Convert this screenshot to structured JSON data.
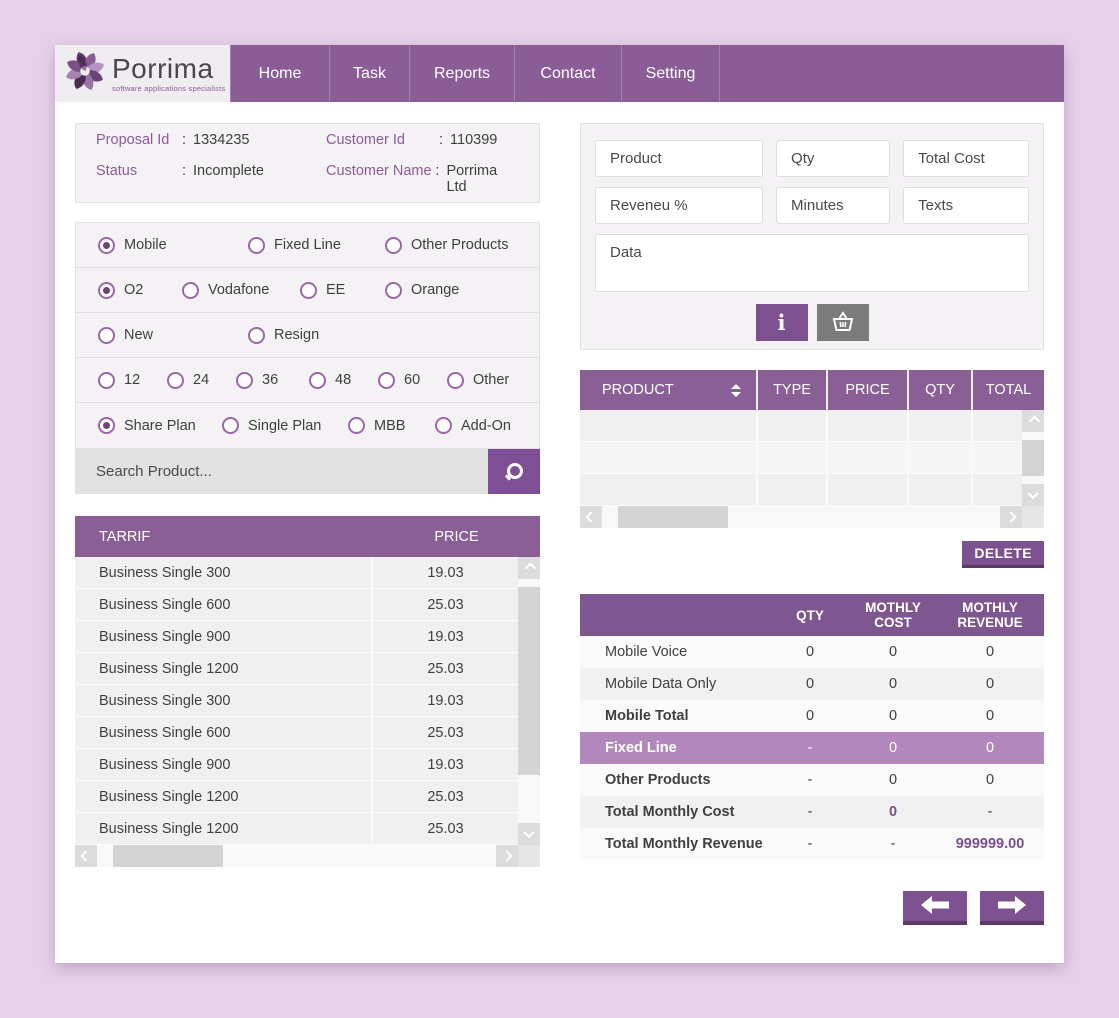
{
  "brand": {
    "name": "Porrima",
    "tagline": "software applications specialists"
  },
  "nav": {
    "items": [
      {
        "label": "Home"
      },
      {
        "label": "Task"
      },
      {
        "label": "Reports"
      },
      {
        "label": "Contact"
      },
      {
        "label": "Setting"
      }
    ]
  },
  "proposal_info": {
    "separator": ":",
    "proposal_id_label": "Proposal Id",
    "proposal_id": "1334235",
    "customer_id_label": "Customer Id",
    "customer_id": "110399",
    "status_label": "Status",
    "status": "Incomplete",
    "customer_name_label": "Customer Name",
    "customer_name": "Porrima Ltd"
  },
  "options": {
    "groups": [
      {
        "options": [
          {
            "label": "Mobile",
            "selected": true
          },
          {
            "label": "Fixed Line",
            "selected": false
          },
          {
            "label": "Other Products",
            "selected": false
          }
        ]
      },
      {
        "options": [
          {
            "label": "O2",
            "selected": true
          },
          {
            "label": "Vodafone",
            "selected": false
          },
          {
            "label": "EE",
            "selected": false
          },
          {
            "label": "Orange",
            "selected": false
          }
        ]
      },
      {
        "options": [
          {
            "label": "New",
            "selected": false
          },
          {
            "label": "Resign",
            "selected": false
          }
        ]
      },
      {
        "options": [
          {
            "label": "12",
            "selected": false
          },
          {
            "label": "24",
            "selected": false
          },
          {
            "label": "36",
            "selected": false
          },
          {
            "label": "48",
            "selected": false
          },
          {
            "label": "60",
            "selected": false
          },
          {
            "label": "Other",
            "selected": false
          }
        ]
      },
      {
        "options": [
          {
            "label": "Share Plan",
            "selected": true
          },
          {
            "label": "Single Plan",
            "selected": false
          },
          {
            "label": "MBB",
            "selected": false
          },
          {
            "label": "Add-On",
            "selected": false
          }
        ]
      }
    ]
  },
  "search": {
    "placeholder": "Search Product..."
  },
  "tariff_table": {
    "headers": {
      "tarrif": "TARRIF",
      "price": "PRICE"
    },
    "rows": [
      {
        "tarrif": "Business Single 300",
        "price": "19.03"
      },
      {
        "tarrif": "Business Single 600",
        "price": "25.03"
      },
      {
        "tarrif": "Business Single 900",
        "price": "19.03"
      },
      {
        "tarrif": "Business Single 1200",
        "price": "25.03"
      },
      {
        "tarrif": "Business Single 300",
        "price": "19.03"
      },
      {
        "tarrif": "Business Single 600",
        "price": "25.03"
      },
      {
        "tarrif": "Business Single 900",
        "price": "19.03"
      },
      {
        "tarrif": "Business Single 1200",
        "price": "25.03"
      },
      {
        "tarrif": "Business Single 1200",
        "price": "25.03"
      }
    ]
  },
  "product_form": {
    "product_placeholder": "Product",
    "qty_placeholder": "Qty",
    "total_cost_placeholder": "Total Cost",
    "revenue_placeholder": "Reveneu %",
    "minutes_placeholder": "Minutes",
    "texts_placeholder": "Texts",
    "data_placeholder": "Data"
  },
  "product_table": {
    "headers": {
      "product": "PRODUCT",
      "type": "TYPE",
      "price": "PRICE",
      "qty": "QTY",
      "total": "TOTAL"
    },
    "empty_row_count": 3
  },
  "actions": {
    "delete_label": "DELETE"
  },
  "summary_table": {
    "headers": {
      "label": "",
      "qty": "QTY",
      "cost": "MOTHLY COST",
      "revenue": "MOTHLY REVENUE"
    },
    "rows": [
      {
        "label": "Mobile Voice",
        "qty": "0",
        "cost": "0",
        "revenue": "0"
      },
      {
        "label": "Mobile Data Only",
        "qty": "0",
        "cost": "0",
        "revenue": "0"
      },
      {
        "label": "Mobile Total",
        "qty": "0",
        "cost": "0",
        "revenue": "0",
        "bold": true
      },
      {
        "label": "Fixed Line",
        "qty": "-",
        "cost": "0",
        "revenue": "0",
        "bold": true,
        "highlighted": true
      },
      {
        "label": "Other Products",
        "qty": "-",
        "cost": "0",
        "revenue": "0",
        "bold": true
      },
      {
        "label": "Total Monthly Cost",
        "qty": "-",
        "cost": "0",
        "revenue": "-",
        "bold": true,
        "cost_accent": true
      },
      {
        "label": "Total Monthly Revenue",
        "qty": "-",
        "cost": "-",
        "revenue": "999999.00",
        "bold": true,
        "revenue_accent": true
      }
    ]
  },
  "colors": {
    "page_background": "#e7d1ea",
    "nav_purple": "#8a5d96",
    "table_header_purple": "#8a5f96",
    "summary_header_purple": "#7e5690",
    "button_purple": "#7b5190",
    "highlight_row_purple": "#b287bb",
    "accent_label_purple": "#8b5a9b",
    "gray_button": "#7b7b7b"
  }
}
